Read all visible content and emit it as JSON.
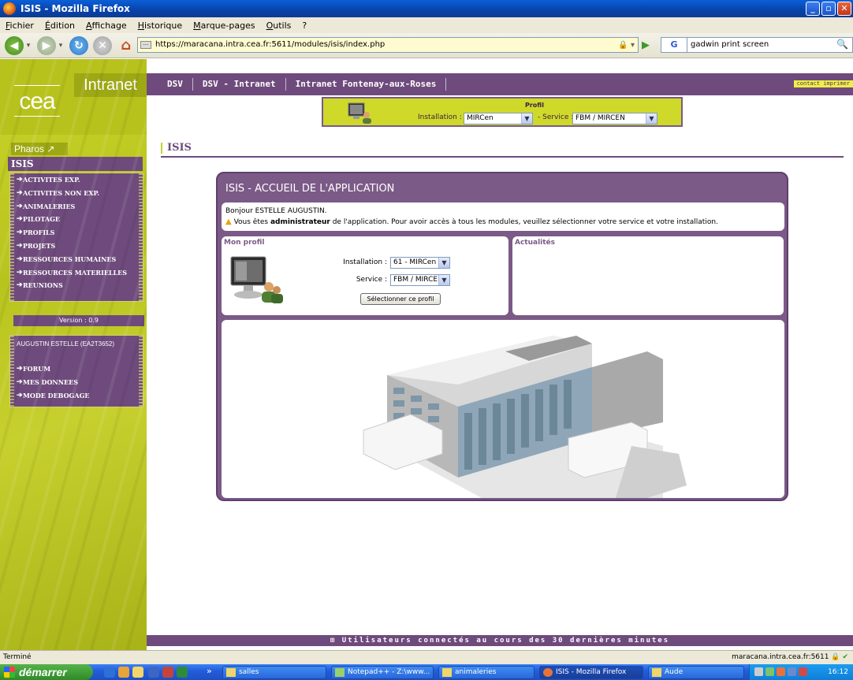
{
  "window": {
    "title": "ISIS - Mozilla Firefox"
  },
  "menubar": {
    "items": [
      "Fichier",
      "Édition",
      "Affichage",
      "Historique",
      "Marque-pages",
      "Outils",
      "?"
    ]
  },
  "navbar": {
    "url": "https://maracana.intra.cea.fr:5611/modules/isis/index.php",
    "search_engine": "G",
    "search_text": "gadwin print screen"
  },
  "sidebar": {
    "brand": "Intranet",
    "logo": "cea",
    "pharos": "Pharos",
    "section_title": "ISIS",
    "menu": [
      "ACTIVITES EXP.",
      "ACTIVITES NON EXP.",
      "ANIMALERIES",
      "PILOTAGE",
      "PROFILS",
      "PROJETS",
      "RESSOURCES HUMAINES",
      "RESSOURCES MATERIELLES",
      "REUNIONS"
    ],
    "version": "Version : 0.9",
    "user": "AUGUSTIN ESTELLE (EA2T3652)",
    "user_menu": [
      "FORUM",
      "MES DONNEES",
      "MODE DEBOGAGE"
    ]
  },
  "topbar": {
    "crumbs": [
      "DSV",
      "DSV - Intranet",
      "Intranet Fontenay-aux-Roses"
    ],
    "links": "contact  imprimer"
  },
  "profil_box": {
    "title": "Profil",
    "installation_label": "Installation :",
    "installation_value": "MIRCen",
    "service_label": "- Service :",
    "service_value": "FBM / MIRCEN"
  },
  "page": {
    "title": "ISIS"
  },
  "card": {
    "title": "ISIS - ACCUEIL DE L'APPLICATION",
    "greeting": "Bonjour ESTELLE AUGUSTIN.",
    "notice_pre": "Vous êtes ",
    "notice_bold": "administrateur",
    "notice_post": " de l'application. Pour avoir accès à tous les modules, veuillez sélectionner votre service et votre installation.",
    "profile": {
      "title": "Mon profil",
      "installation_label": "Installation :",
      "installation_value": "61 - MIRCen",
      "service_label": "Service :",
      "service_value": "FBM / MIRCEN",
      "button": "Sélectionner ce profil"
    },
    "news": {
      "title": "Actualités"
    }
  },
  "bottom_bar": "Utilisateurs connectés au cours des 30 dernières minutes",
  "statusbar": {
    "left": "Terminé",
    "right": "maracana.intra.cea.fr:5611"
  },
  "taskbar": {
    "start": "démarrer",
    "tasks": [
      "salles",
      "Notepad++ - Z:\\www...",
      "animaleries",
      "ISIS - Mozilla Firefox",
      "Aude"
    ],
    "clock": "16:12"
  },
  "colors": {
    "purple": "#6e4b7c",
    "lime": "#c7d02e"
  }
}
